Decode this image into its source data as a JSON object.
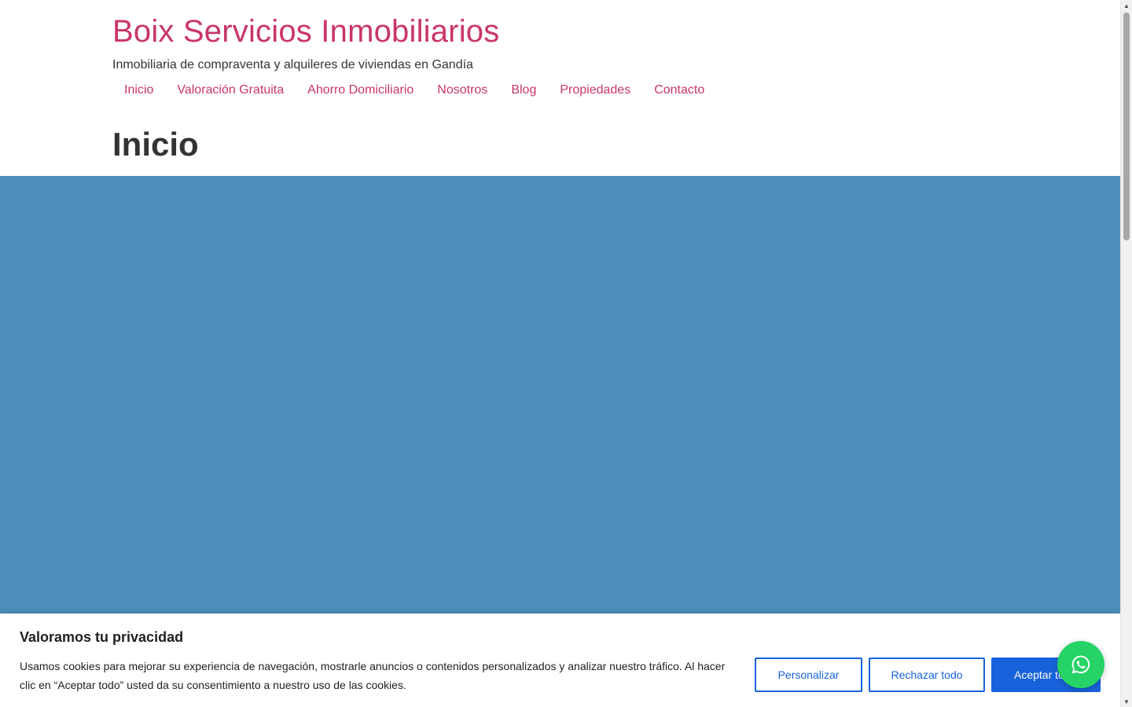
{
  "site": {
    "title": "Boix Servicios Inmobiliarios",
    "tagline": "Inmobiliaria de compraventa y alquileres de viviendas en Gandía"
  },
  "nav": {
    "items": [
      {
        "label": "Inicio"
      },
      {
        "label": "Valoración Gratuita"
      },
      {
        "label": "Ahorro Domiciliario"
      },
      {
        "label": "Nosotros"
      },
      {
        "label": "Blog"
      },
      {
        "label": "Propiedades"
      },
      {
        "label": "Contacto"
      }
    ]
  },
  "page": {
    "title": "Inicio"
  },
  "cookie_banner": {
    "title": "Valoramos tu privacidad",
    "text": "Usamos cookies para mejorar su experiencia de navegación, mostrarle anuncios o contenidos personalizados y analizar nuestro tráfico. Al hacer clic en “Aceptar todo” usted da su consentimiento a nuestro uso de las cookies.",
    "customize_label": "Personalizar",
    "reject_label": "Rechazar todo",
    "accept_label": "Aceptar todo"
  },
  "icons": {
    "whatsapp": "whatsapp-icon"
  },
  "colors": {
    "brand": "#c9356b",
    "hero": "#4e8ebd",
    "cookie_button": "#1863dc",
    "whatsapp": "#25d366"
  }
}
